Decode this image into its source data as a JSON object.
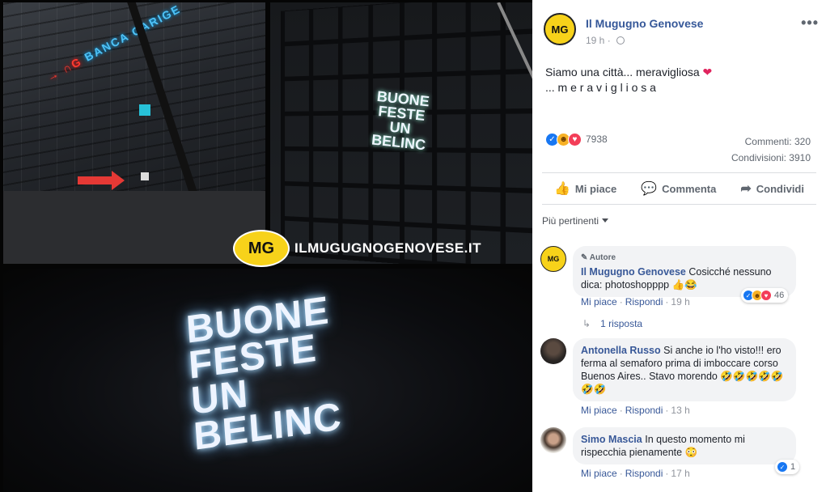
{
  "photos": {
    "bank_sign": "BANCA CARIGE",
    "bank_sign_prefix": "→ ∩G",
    "small_sign": "BUONE FESTE UN BELINC",
    "big_sign": "BUONE FESTE UN BELINC",
    "watermark_logo": "MG",
    "watermark_text": "ILMUGUGNOGENOVESE.IT"
  },
  "post": {
    "page_logo": "MG",
    "page_name": "Il Mugugno Genovese",
    "time": "19 h",
    "more_icon": "•••",
    "text_line1": "Siamo una città... meravigliosa",
    "heart": "❤",
    "text_line2": "... m e r a v i g l i o s a",
    "reaction_count": "7938",
    "comments_count": "Commenti: 320",
    "shares_count": "Condivisioni: 3910",
    "reaction_icons": [
      "like-icon",
      "haha-icon",
      "love-icon"
    ]
  },
  "actions": {
    "like": "Mi piace",
    "comment": "Commenta",
    "share": "Condividi"
  },
  "comments_filter": "Più pertinenti",
  "comments": [
    {
      "badge": "Autore",
      "name": "Il Mugugno Genovese",
      "text": "Cosicché nessuno dica: photoshopppp 👍😂",
      "like": "Mi piace",
      "reply": "Rispondi",
      "time": "19 h",
      "reactions": "46"
    },
    {
      "name": "Antonella Russo",
      "text": "Si anche io l'ho visto!!! ero ferma al semaforo prima di imboccare corso Buenos Aires.. Stavo morendo 🤣🤣🤣🤣🤣🤣🤣",
      "like": "Mi piace",
      "reply": "Rispondi",
      "time": "13 h"
    },
    {
      "name": "Simo Mascia",
      "text": "In questo momento mi rispecchia pienamente 😳",
      "like": "Mi piace",
      "reply": "Rispondi",
      "time": "17 h",
      "reactions": "1"
    }
  ],
  "replies_link": "1 risposta",
  "colors": {
    "link_blue": "#365899",
    "like_blue": "#1877f2",
    "haha_yellow": "#f7b125",
    "love_red": "#f33e58",
    "logo_yellow": "#f7d21a"
  }
}
